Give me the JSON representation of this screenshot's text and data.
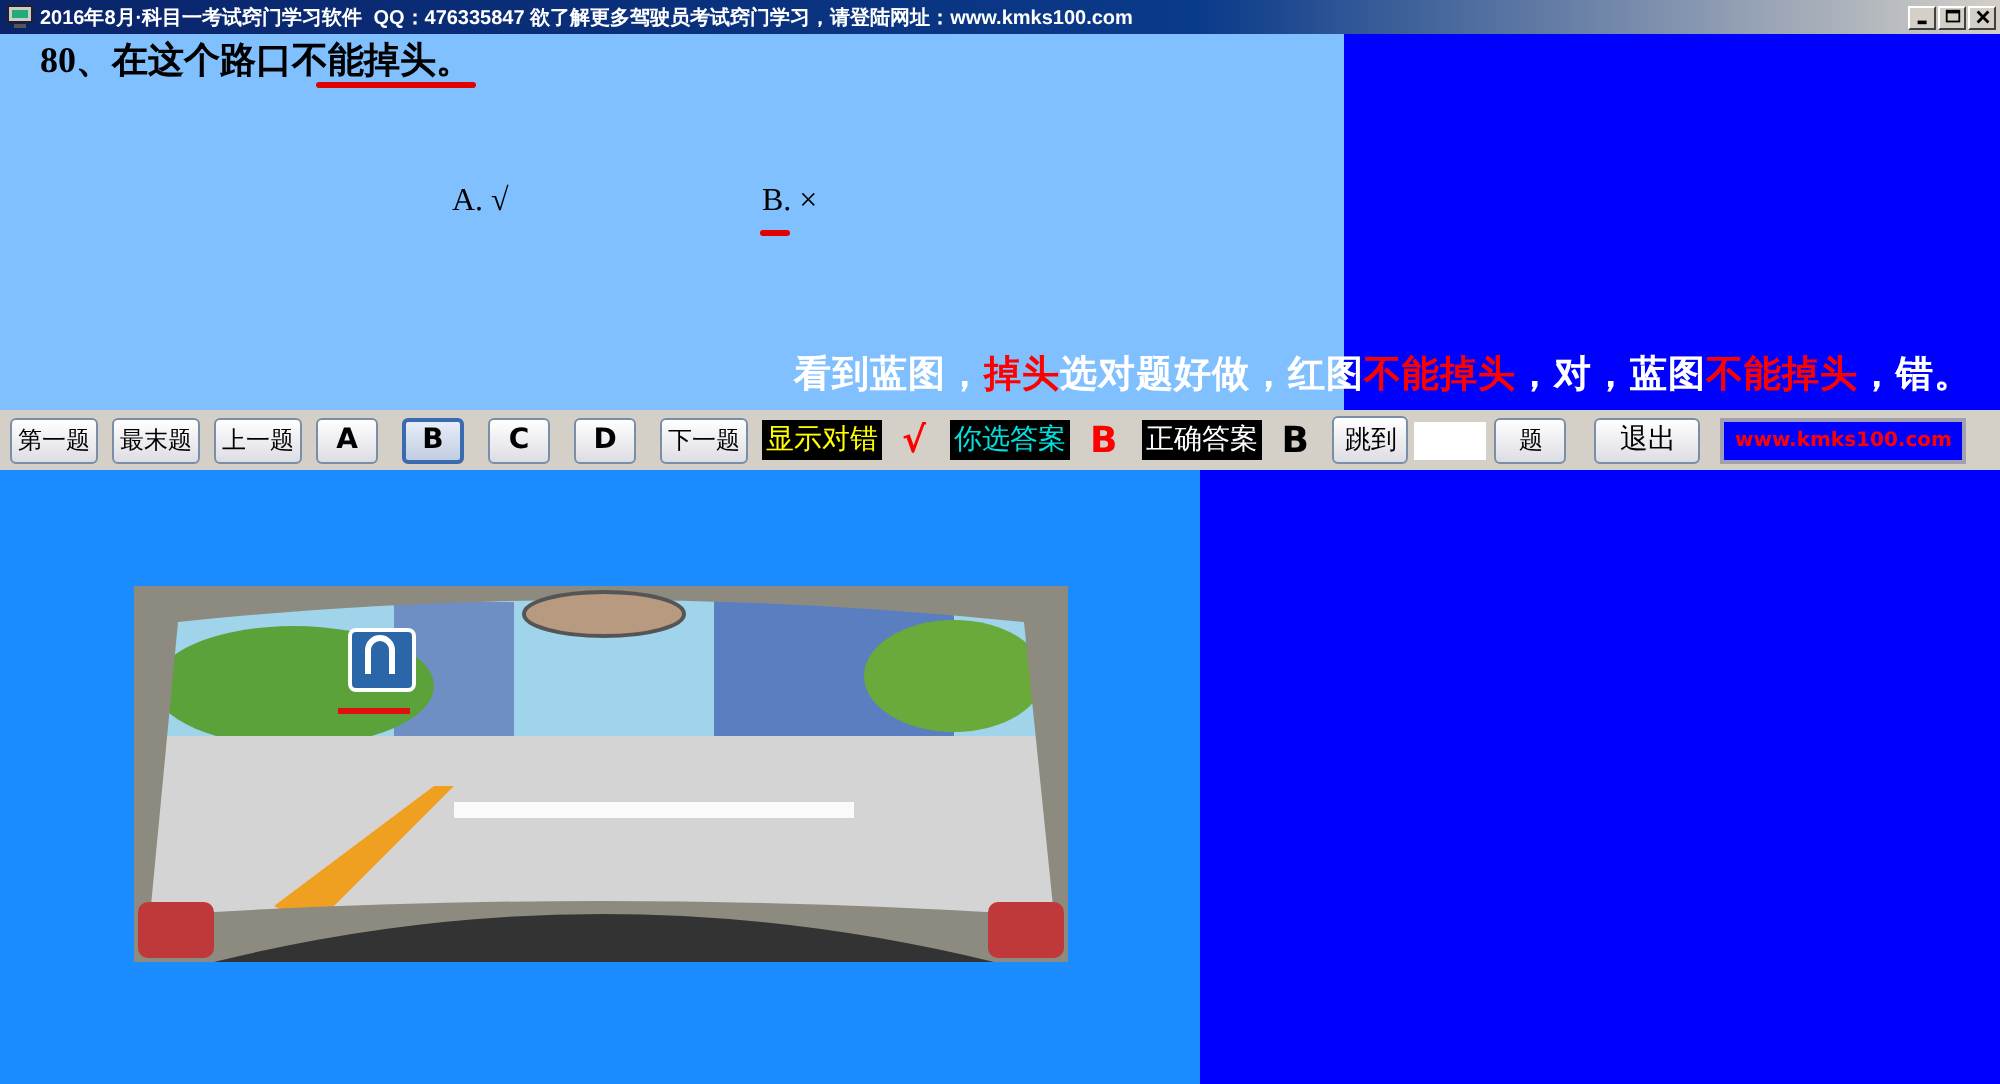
{
  "window": {
    "title": "2016年8月·科目一考试窍门学习软件  QQ：476335847 欲了解更多驾驶员考试窍门学习，请登陆网址：www.kmks100.com"
  },
  "question": {
    "text": "80、在这个路口不能掉头。",
    "options": [
      {
        "label": "A. √",
        "selected": false
      },
      {
        "label": "B. ×",
        "selected": true
      }
    ],
    "hint": [
      {
        "text": "看到蓝图，",
        "highlight": false
      },
      {
        "text": "掉头",
        "highlight": true
      },
      {
        "text": "选对题好做，红图",
        "highlight": false
      },
      {
        "text": "不能掉头",
        "highlight": true
      },
      {
        "text": "，对，蓝图",
        "highlight": false
      },
      {
        "text": "不能掉头",
        "highlight": true
      },
      {
        "text": "，错。",
        "highlight": false
      }
    ]
  },
  "toolbar": {
    "nav_buttons": [
      "第一题",
      "最末题",
      "上一题"
    ],
    "answer_buttons": [
      {
        "label": "A",
        "selected": false
      },
      {
        "label": "B",
        "selected": true
      },
      {
        "label": "C",
        "selected": false
      },
      {
        "label": "D",
        "selected": false
      }
    ],
    "next_button": "下一题",
    "show_result_label": "显示对错",
    "result_mark": "√",
    "your_answer_label": "你选答案",
    "your_answer": "B",
    "correct_answer_label": "正确答案",
    "correct_answer": "B",
    "jump_button": "跳到",
    "page_button": "题",
    "exit_button": "退出",
    "website": "www.kmks100.com"
  }
}
